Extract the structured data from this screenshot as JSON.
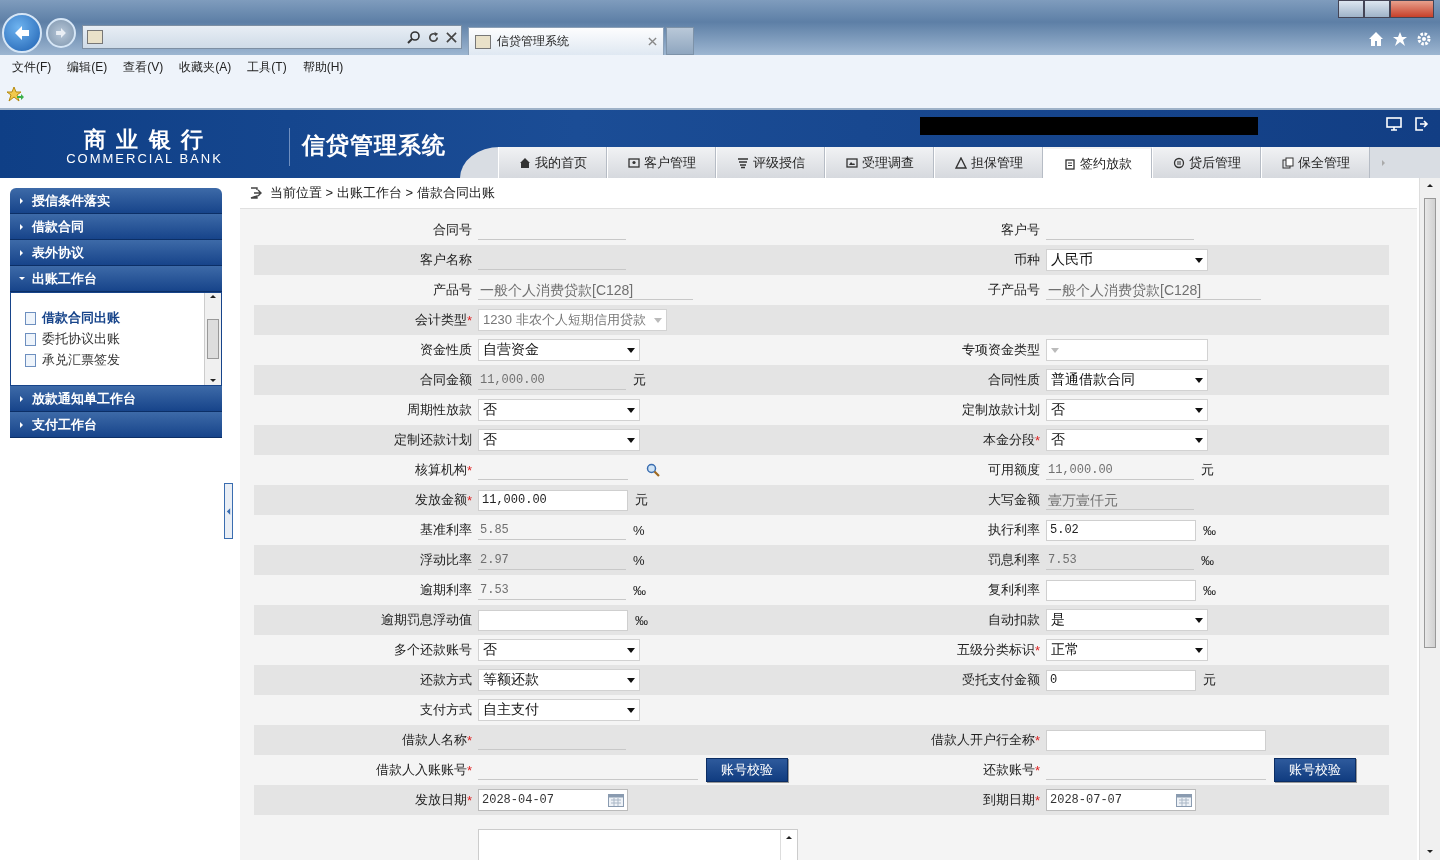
{
  "browser": {
    "tab_title": "信贷管理系统",
    "menu": [
      "文件(F)",
      "编辑(E)",
      "查看(V)",
      "收藏夹(A)",
      "工具(T)",
      "帮助(H)"
    ]
  },
  "app": {
    "bank_name": "商 业 银 行",
    "bank_name_en": "COMMERCIAL BANK",
    "system_name": "信贷管理系统",
    "nav_tabs": [
      {
        "label": "我的首页",
        "selected": false
      },
      {
        "label": "客户管理",
        "selected": false
      },
      {
        "label": "评级授信",
        "selected": false
      },
      {
        "label": "受理调查",
        "selected": false
      },
      {
        "label": "担保管理",
        "selected": false
      },
      {
        "label": "签约放款",
        "selected": true
      },
      {
        "label": "贷后管理",
        "selected": false
      },
      {
        "label": "保全管理",
        "selected": false
      }
    ]
  },
  "sidebar": {
    "groups": [
      {
        "label": "授信条件落实",
        "expanded": false
      },
      {
        "label": "借款合同",
        "expanded": false
      },
      {
        "label": "表外协议",
        "expanded": false
      },
      {
        "label": "出账工作台",
        "expanded": true,
        "items": [
          {
            "label": "借款合同出账",
            "selected": true
          },
          {
            "label": "委托协议出账",
            "selected": false
          },
          {
            "label": "承兑汇票签发",
            "selected": false
          }
        ]
      },
      {
        "label": "放款通知单工作台",
        "expanded": false
      },
      {
        "label": "支付工作台",
        "expanded": false
      }
    ]
  },
  "breadcrumb": "当前位置 > 出账工作台 > 借款合同出账",
  "form": {
    "rows": [
      {
        "left": {
          "label": "合同号",
          "kind": "readonly"
        },
        "right": {
          "label": "客户号",
          "kind": "readonly"
        }
      },
      {
        "left": {
          "label": "客户名称",
          "kind": "readonly"
        },
        "right": {
          "label": "币种",
          "kind": "select",
          "value": "人民币"
        }
      },
      {
        "left": {
          "label": "产品号",
          "kind": "readonly",
          "value": "一般个人消费贷款[C128]"
        },
        "right": {
          "label": "子产品号",
          "kind": "readonly",
          "value": "一般个人消费贷款[C128]"
        }
      },
      {
        "left": {
          "label": "会计类型",
          "required_mark": "*",
          "kind": "select",
          "value": "1230 非农个人短期信用贷款",
          "disabled": true
        }
      },
      {
        "left": {
          "label": "资金性质",
          "kind": "select",
          "value": "自营资金"
        },
        "right": {
          "label": "专项资金类型",
          "kind": "select",
          "disabled": true
        }
      },
      {
        "left": {
          "label": "合同金额",
          "kind": "readonly",
          "value": "11,000.00",
          "unit": "元"
        },
        "right": {
          "label": "合同性质",
          "kind": "select",
          "value": "普通借款合同"
        }
      },
      {
        "left": {
          "label": "周期性放款",
          "kind": "select",
          "value": "否"
        },
        "right": {
          "label": "定制放款计划",
          "kind": "select",
          "value": "否"
        }
      },
      {
        "left": {
          "label": "定制还款计划",
          "kind": "select",
          "value": "否"
        },
        "right": {
          "label": "本金分段",
          "required_mark": "*",
          "kind": "select",
          "value": "否"
        }
      },
      {
        "left": {
          "label": "核算机构",
          "required_mark": "*",
          "kind": "search"
        },
        "right": {
          "label": "可用额度",
          "kind": "readonly",
          "value": "11,000.00",
          "unit": "元"
        }
      },
      {
        "left": {
          "label": "发放金额",
          "required_mark": "*",
          "kind": "input",
          "value": "11,000.00",
          "unit": "元"
        },
        "right": {
          "label": "大写金额",
          "kind": "readonly",
          "value": "壹万壹仟元"
        }
      },
      {
        "left": {
          "label": "基准利率",
          "kind": "readonly",
          "value": "5.85",
          "unit": "%"
        },
        "right": {
          "label": "执行利率",
          "kind": "input",
          "value": "5.02",
          "unit": "‰"
        }
      },
      {
        "left": {
          "label": "浮动比率",
          "kind": "readonly",
          "value": "2.97",
          "unit": "%"
        },
        "right": {
          "label": "罚息利率",
          "kind": "readonly",
          "value": "7.53",
          "unit": "‰"
        }
      },
      {
        "left": {
          "label": "逾期利率",
          "kind": "readonly",
          "value": "7.53",
          "unit": "‰"
        },
        "right": {
          "label": "复利利率",
          "kind": "input",
          "unit": "‰"
        }
      },
      {
        "left": {
          "label": "逾期罚息浮动值",
          "kind": "input",
          "unit": "‰"
        },
        "right": {
          "label": "自动扣款",
          "kind": "select",
          "value": "是"
        }
      },
      {
        "left": {
          "label": "多个还款账号",
          "kind": "select",
          "value": "否"
        },
        "right": {
          "label": "五级分类标识",
          "required_mark": "*",
          "kind": "select",
          "value": "正常"
        }
      },
      {
        "left": {
          "label": "还款方式",
          "kind": "select",
          "value": "等额还款"
        },
        "right": {
          "label": "受托支付金额",
          "kind": "input",
          "value": "0",
          "unit": "元"
        }
      },
      {
        "left": {
          "label": "支付方式",
          "kind": "select",
          "value": "自主支付"
        }
      },
      {
        "left": {
          "label": "借款人名称",
          "required_mark": "*",
          "kind": "readonly"
        },
        "right": {
          "label": "借款人开户行全称",
          "required_mark": "*",
          "kind": "longinput"
        }
      },
      {
        "left": {
          "label": "借款人入账账号",
          "required_mark": "*",
          "kind": "account",
          "button": "账号校验"
        },
        "right": {
          "label": "还款账号",
          "required_mark": "*",
          "kind": "account",
          "button": "账号校验"
        }
      },
      {
        "left": {
          "label": "发放日期",
          "required_mark": "*",
          "kind": "date",
          "value": "2028-04-07"
        },
        "right": {
          "label": "到期日期",
          "required_mark": "*",
          "kind": "date",
          "value": "2028-07-07"
        }
      },
      {
        "left": {
          "kind": "textarea"
        }
      }
    ]
  }
}
